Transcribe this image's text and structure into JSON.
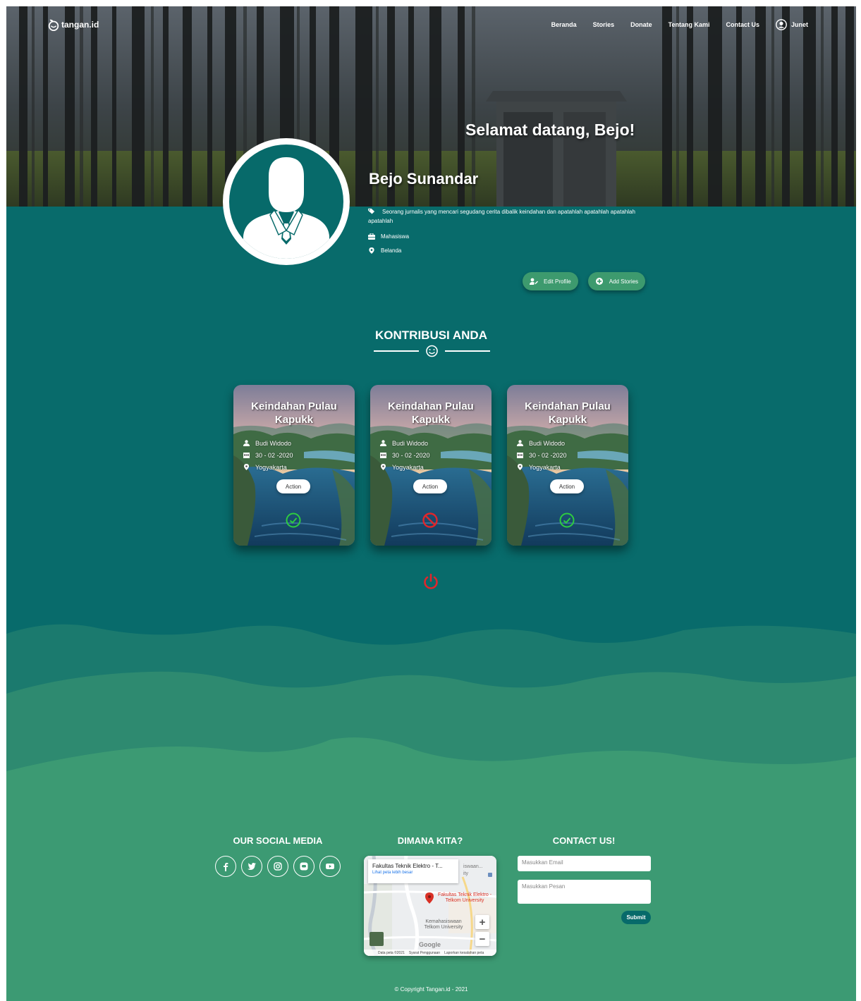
{
  "nav": {
    "brand": "tangan.id",
    "links": [
      "Beranda",
      "Stories",
      "Donate",
      "Tentang Kami",
      "Contact Us"
    ],
    "user": "Junet"
  },
  "hero": {
    "welcome": "Selamat datang, Bejo!",
    "name": "Bejo Sunandar"
  },
  "profile": {
    "bio": "Seorang jurnalis yang mencari segudang cerita dibalik keindahan dan apatahlah apatahlah apatahlah apatahlah",
    "job": "Mahasiswa",
    "location": "Belanda",
    "edit_label": "Edit Profile",
    "add_label": "Add Stories"
  },
  "contributions": {
    "title": "KONTRIBUSI ANDA",
    "cards": [
      {
        "title": "Keindahan Pulau Kapukk",
        "author": "Budi Widodo",
        "date": "30 - 02 -2020",
        "place": "Yogyakarta",
        "action": "Action",
        "status": "approved"
      },
      {
        "title": "Keindahan Pulau Kapukk",
        "author": "Budi Widodo",
        "date": "30 - 02 -2020",
        "place": "Yogyakarta",
        "action": "Action",
        "status": "rejected"
      },
      {
        "title": "Keindahan Pulau Kapukk",
        "author": "Budi Widodo",
        "date": "30 - 02 -2020",
        "place": "Yogyakarta",
        "action": "Action",
        "status": "approved"
      }
    ]
  },
  "footer": {
    "social_title": "OUR SOCIAL MEDIA",
    "socials": [
      "facebook-icon",
      "twitter-icon",
      "instagram-icon",
      "line-icon",
      "youtube-icon"
    ],
    "map_title": "DIMANA KITA?",
    "map": {
      "place": "Fakultas Teknik Elektro - T...",
      "link": "Lihat peta lebih besar",
      "pin_label": "Fakultas Teknik Elektro - Telkom University",
      "nearby": "Kemahasiswaan Telkom University",
      "brand": "Google",
      "footer": [
        "Data peta ©2021",
        "Syarat Penggunaan",
        "Laporkan kesalahan peta"
      ],
      "partial_top": "iswaan...",
      "partial_top2": "ity"
    },
    "contact_title": "CONTACT US!",
    "email_placeholder": "Masukkan Email",
    "message_placeholder": "Masukkan Pesan",
    "submit": "Submit",
    "copyright": "© Copyright Tangan.id - 2021"
  },
  "colors": {
    "teal": "#076a6a",
    "green_button": "#3d9a6e",
    "approved": "#2ecc40",
    "rejected": "#e0262b"
  }
}
